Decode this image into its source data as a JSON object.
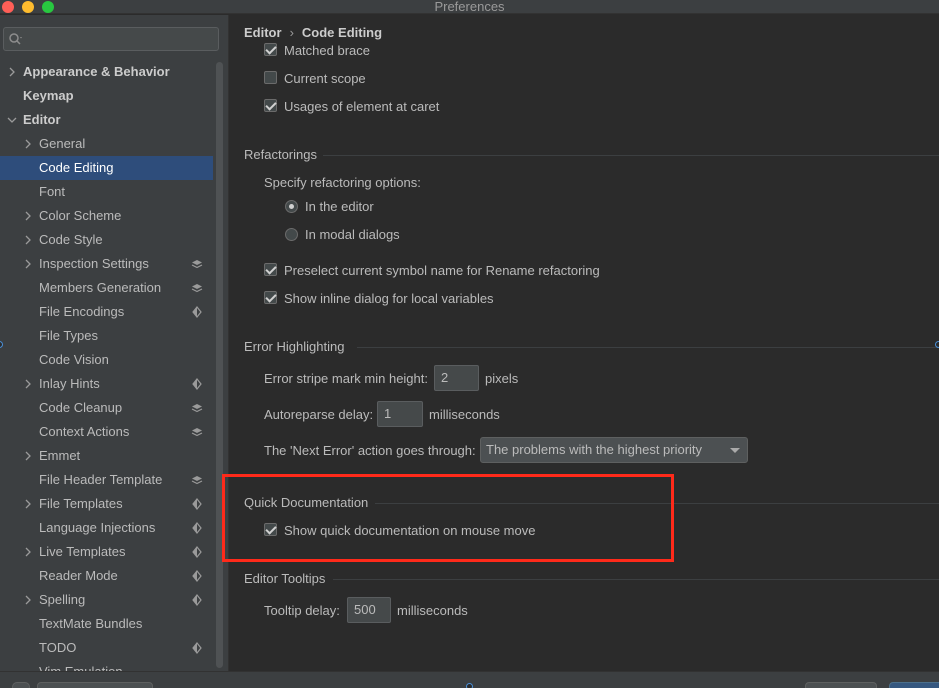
{
  "window": {
    "title": "Preferences"
  },
  "search": {
    "placeholder": ""
  },
  "sidebar": {
    "items": [
      {
        "label": "Appearance & Behavior",
        "level": 0,
        "expandable": true,
        "expanded": false,
        "bold": true
      },
      {
        "label": "Keymap",
        "level": 0,
        "expandable": false,
        "bold": true
      },
      {
        "label": "Editor",
        "level": 0,
        "expandable": true,
        "expanded": true,
        "bold": true
      },
      {
        "label": "General",
        "level": 1,
        "expandable": true,
        "expanded": false
      },
      {
        "label": "Code Editing",
        "level": 1,
        "expandable": false,
        "selected": true
      },
      {
        "label": "Font",
        "level": 1,
        "expandable": false
      },
      {
        "label": "Color Scheme",
        "level": 1,
        "expandable": true,
        "expanded": false
      },
      {
        "label": "Code Style",
        "level": 1,
        "expandable": true,
        "expanded": false
      },
      {
        "label": "Inspection Settings",
        "level": 1,
        "expandable": true,
        "expanded": false,
        "badge": "layers-icon"
      },
      {
        "label": "Members Generation",
        "level": 1,
        "expandable": false,
        "badge": "layers-icon"
      },
      {
        "label": "File Encodings",
        "level": 1,
        "expandable": false,
        "badge": "project-icon"
      },
      {
        "label": "File Types",
        "level": 1,
        "expandable": false
      },
      {
        "label": "Code Vision",
        "level": 1,
        "expandable": false
      },
      {
        "label": "Inlay Hints",
        "level": 1,
        "expandable": true,
        "expanded": false,
        "badge": "project-icon"
      },
      {
        "label": "Code Cleanup",
        "level": 1,
        "expandable": false,
        "badge": "layers-icon"
      },
      {
        "label": "Context Actions",
        "level": 1,
        "expandable": false,
        "badge": "layers-icon"
      },
      {
        "label": "Emmet",
        "level": 1,
        "expandable": true,
        "expanded": false
      },
      {
        "label": "File Header Template",
        "level": 1,
        "expandable": false,
        "badge": "layers-icon"
      },
      {
        "label": "File Templates",
        "level": 1,
        "expandable": true,
        "expanded": false,
        "badge": "project-icon"
      },
      {
        "label": "Language Injections",
        "level": 1,
        "expandable": false,
        "badge": "project-icon"
      },
      {
        "label": "Live Templates",
        "level": 1,
        "expandable": true,
        "expanded": false,
        "badge": "project-icon"
      },
      {
        "label": "Reader Mode",
        "level": 1,
        "expandable": false,
        "badge": "project-icon"
      },
      {
        "label": "Spelling",
        "level": 1,
        "expandable": true,
        "expanded": false,
        "badge": "project-icon"
      },
      {
        "label": "TextMate Bundles",
        "level": 1,
        "expandable": false
      },
      {
        "label": "TODO",
        "level": 1,
        "expandable": false,
        "badge": "project-icon"
      },
      {
        "label": "Vim Emulation",
        "level": 1,
        "expandable": false
      }
    ]
  },
  "breadcrumb": {
    "parent": "Editor",
    "separator": "›",
    "current": "Code Editing"
  },
  "brace": {
    "matched_brace": {
      "label": "Matched brace",
      "checked": true
    },
    "current_scope": {
      "label": "Current scope",
      "checked": false
    },
    "usages_at_caret": {
      "label": "Usages of element at caret",
      "checked": true
    }
  },
  "refactorings": {
    "title": "Refactorings",
    "specify_label": "Specify refactoring options:",
    "in_editor": {
      "label": "In the editor",
      "selected": true
    },
    "in_modal": {
      "label": "In modal dialogs",
      "selected": false
    },
    "preselect_rename": {
      "label": "Preselect current symbol name for Rename refactoring",
      "checked": true
    },
    "inline_dialog": {
      "label": "Show inline dialog for local variables",
      "checked": true
    }
  },
  "error_highlighting": {
    "title": "Error Highlighting",
    "stripe_label": "Error stripe mark min height:",
    "stripe_value": "2",
    "stripe_unit": "pixels",
    "autoreparse_label": "Autoreparse delay:",
    "autoreparse_value": "1",
    "autoreparse_unit": "milliseconds",
    "next_error_label": "The 'Next Error' action goes through:",
    "next_error_value": "The problems with the highest priority"
  },
  "quick_docs": {
    "title": "Quick Documentation",
    "mouse_move": {
      "label": "Show quick documentation on mouse move",
      "checked": true
    }
  },
  "tooltips": {
    "title": "Editor Tooltips",
    "delay_label": "Tooltip delay:",
    "delay_value": "500",
    "delay_unit": "milliseconds"
  },
  "colors": {
    "selection": "#2e4d7b",
    "highlight_box": "#ff2a1a",
    "window_bg": "#2b2b2b",
    "sidebar_bg": "#3c3f41"
  }
}
